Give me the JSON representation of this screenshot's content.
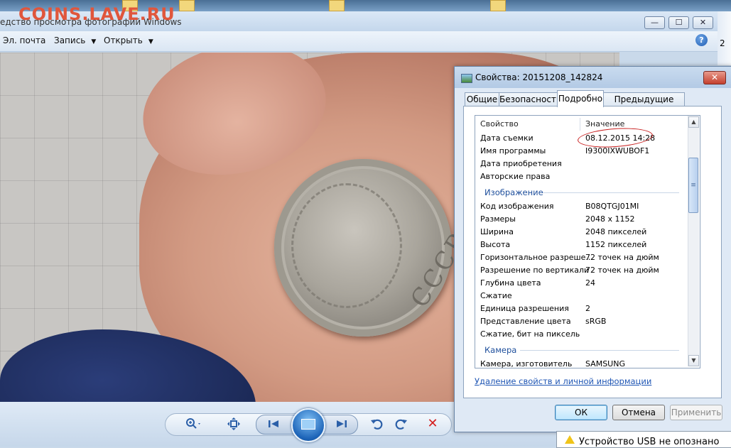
{
  "watermark": "COINS.LAVE.RU",
  "viewer": {
    "title": "едство просмотра фотографий Windows",
    "menu": [
      {
        "label": "Эл. почта",
        "has_arrow": false
      },
      {
        "label": "Запись",
        "has_arrow": true
      },
      {
        "label": "Открыть",
        "has_arrow": true
      }
    ],
    "help_label": "?",
    "window_buttons": {
      "minimize": "—",
      "maximize": "☐",
      "close": "✕"
    },
    "right_edge_text": "2",
    "photo": {
      "coin_text": "СССР"
    },
    "toolbar": {
      "zoom_icon": "zoom-icon",
      "fit_icon": "fit-to-window-icon",
      "prev_icon": "previous-icon",
      "slideshow_icon": "slideshow-icon",
      "next_icon": "next-icon",
      "rotate_ccw_icon": "rotate-counterclockwise-icon",
      "rotate_cw_icon": "rotate-clockwise-icon",
      "delete_icon": "delete-icon"
    }
  },
  "dialog": {
    "title": "Свойства: 20151208_142824",
    "close_label": "✕",
    "tabs": [
      "Общие",
      "Безопасность",
      "Подробно",
      "Предыдущие версии"
    ],
    "active_tab": "Подробно",
    "columns": {
      "property": "Свойство",
      "value": "Значение"
    },
    "rows_top": [
      {
        "label": "Дата съемки",
        "value": "08.12.2015 14:28"
      },
      {
        "label": "Имя программы",
        "value": "I9300IXWUBOF1"
      },
      {
        "label": "Дата приобретения",
        "value": ""
      },
      {
        "label": "Авторские права",
        "value": ""
      }
    ],
    "group_image": "Изображение",
    "rows_image": [
      {
        "label": "Код изображения",
        "value": "B08QTGJ01MI"
      },
      {
        "label": "Размеры",
        "value": "2048 x 1152"
      },
      {
        "label": "Ширина",
        "value": "2048 пикселей"
      },
      {
        "label": "Высота",
        "value": "1152 пикселей"
      },
      {
        "label": "Горизонтальное разреше...",
        "value": "72 точек на дюйм"
      },
      {
        "label": "Разрешение по вертикали",
        "value": "72 точек на дюйм"
      },
      {
        "label": "Глубина цвета",
        "value": "24"
      },
      {
        "label": "Сжатие",
        "value": ""
      },
      {
        "label": "Единица разрешения",
        "value": "2"
      },
      {
        "label": "Представление цвета",
        "value": "sRGB"
      },
      {
        "label": "Сжатие, бит на пиксель",
        "value": ""
      }
    ],
    "group_camera": "Камера",
    "rows_camera": [
      {
        "label": "Камера, изготовитель",
        "value": "SAMSUNG"
      }
    ],
    "remove_link": "Удаление свойств и личной информации",
    "buttons": {
      "ok": "ОК",
      "cancel": "Отмена",
      "apply": "Применить"
    }
  },
  "notification": {
    "text": "Устройство USB не опознано"
  }
}
